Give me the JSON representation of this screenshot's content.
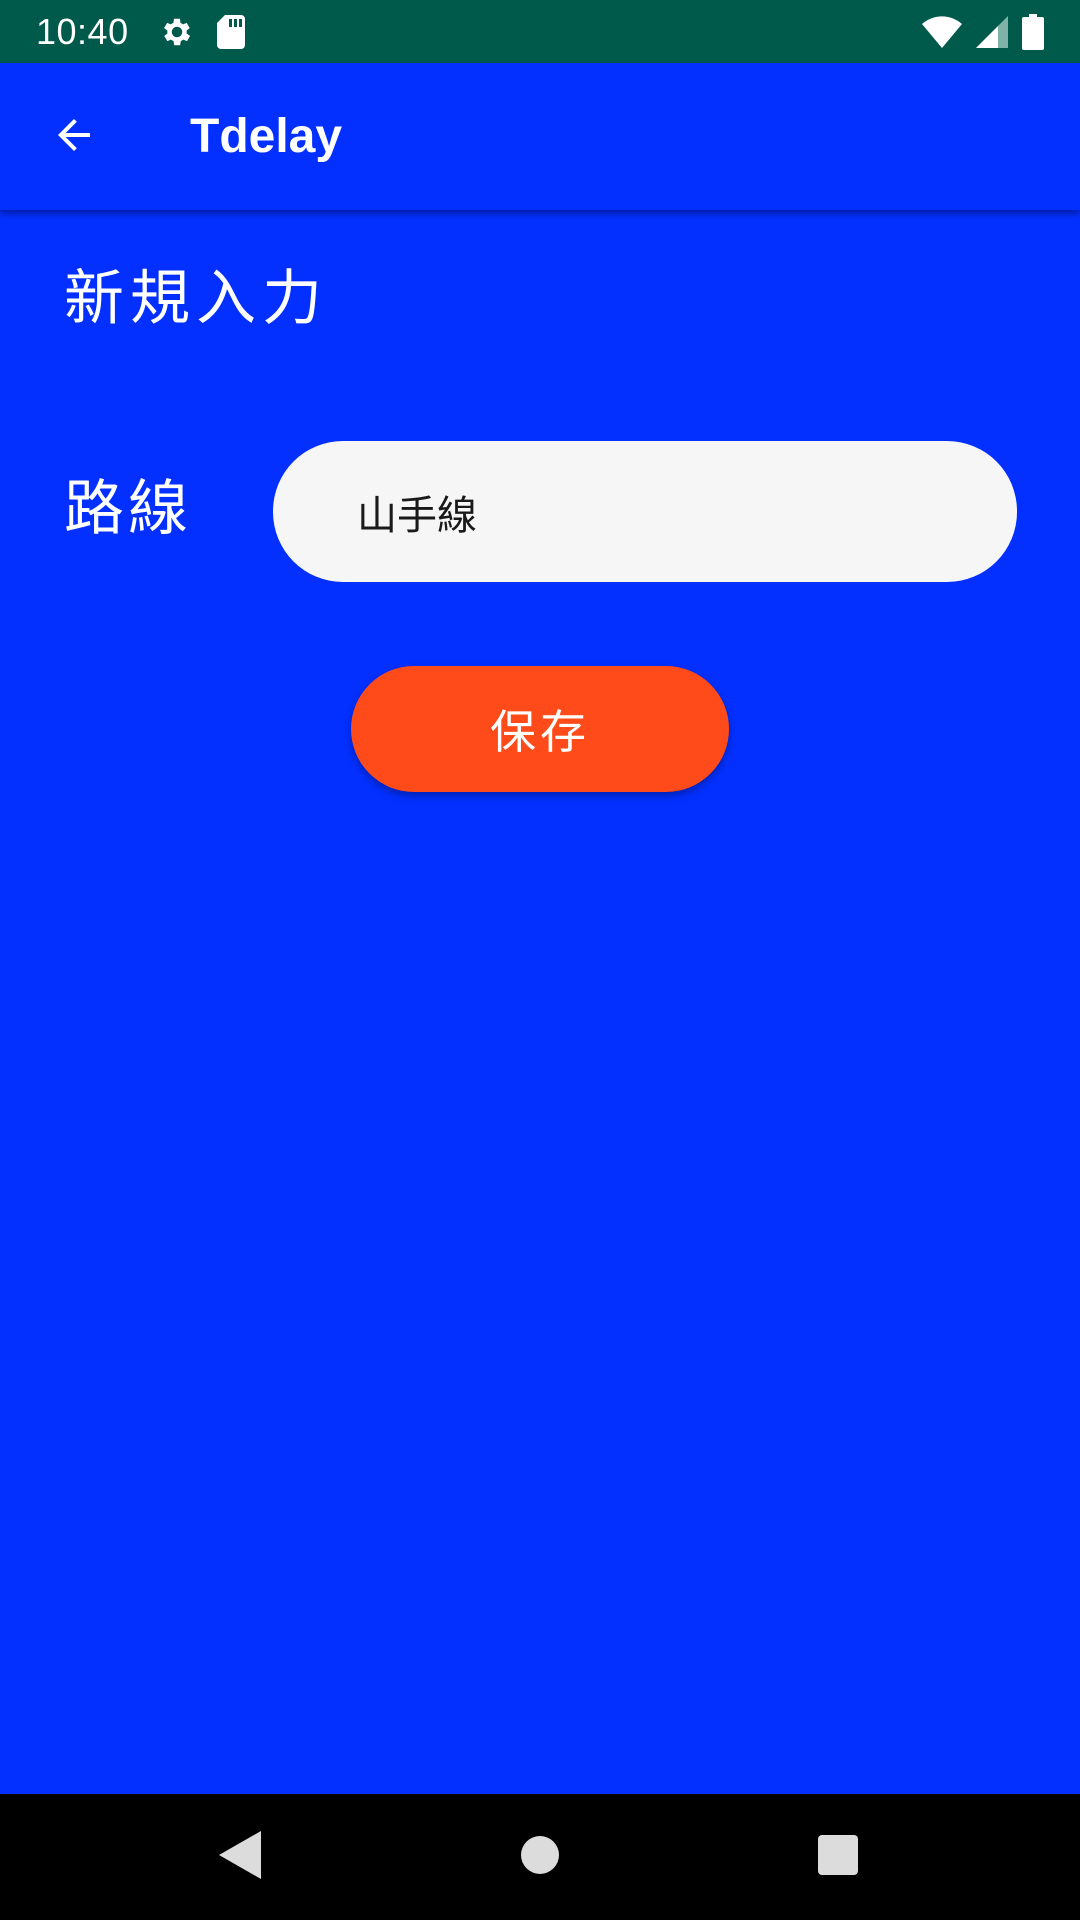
{
  "status_bar": {
    "time": "10:40",
    "icons": [
      "gear-icon",
      "sd-card-icon",
      "wifi-icon",
      "cell-signal-icon",
      "battery-icon"
    ]
  },
  "app_bar": {
    "title": "Tdelay",
    "back_icon": "arrow-back-icon"
  },
  "form": {
    "heading": "新規入力",
    "route_label": "路線",
    "route_value": "山手線",
    "save_label": "保存"
  },
  "nav_bar": {
    "icons": [
      "nav-back-icon",
      "nav-home-icon",
      "nav-recents-icon"
    ]
  },
  "colors": {
    "status_bar": "#005A4C",
    "background": "#0330FF",
    "input_background": "#F7F6F6",
    "save_button": "#FF4B19",
    "nav_bar": "#000000"
  }
}
